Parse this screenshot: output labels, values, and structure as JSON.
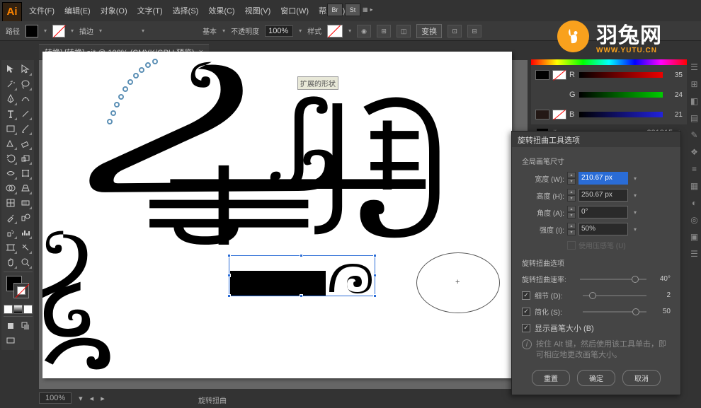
{
  "brand": {
    "name": "羽兔网",
    "url": "WWW.YUTU.CN"
  },
  "app_badge": "Ai",
  "menus": [
    "文件(F)",
    "编辑(E)",
    "对象(O)",
    "文字(T)",
    "选择(S)",
    "效果(C)",
    "视图(V)",
    "窗口(W)",
    "帮助(H)"
  ],
  "top_btn": {
    "br": "Br",
    "st": "St"
  },
  "ctrl": {
    "left_label": "路径",
    "stroke_label": "描边",
    "stroke_dd": "",
    "brush_style": "基本",
    "opacity_label": "不透明度",
    "opacity_value": "100%",
    "style_label": "样式",
    "transform_btn": "变换"
  },
  "doc_tab": {
    "title": "转换] [转换].ai* @ 100% (CMYK/GPU 预览)",
    "close": "×"
  },
  "tooltip": "扩展的形状",
  "right_panel": {
    "rows": [
      {
        "letter": "R",
        "val": "35"
      },
      {
        "letter": "G",
        "val": "24"
      },
      {
        "letter": "B",
        "val": "21"
      }
    ],
    "hex_label": "#",
    "hex": "231815"
  },
  "dialog": {
    "title": "旋转扭曲工具选项",
    "sec1": "全局画笔尺寸",
    "rows": [
      {
        "label": "宽度 (W):",
        "value": "210.67 px"
      },
      {
        "label": "高度 (H):",
        "value": "250.67 px"
      },
      {
        "label": "角度 (A):",
        "value": "0°"
      },
      {
        "label": "强度 (I):",
        "value": "50%"
      }
    ],
    "pressure": "使用压感笔 (U)",
    "sec2": "旋转扭曲选项",
    "sliders": [
      {
        "label": "旋转扭曲速率:",
        "value": "40°",
        "pos": 78,
        "cb": false
      },
      {
        "label": "细节 (D):",
        "value": "2",
        "pos": 10,
        "cb": true
      },
      {
        "label": "简化 (S):",
        "value": "50",
        "pos": 78,
        "cb": true
      }
    ],
    "show_size": "显示画笔大小 (B)",
    "info": "按住 Alt 键，然后使用该工具单击，即可相应地更改画笔大小。",
    "btns": {
      "reset": "重置",
      "ok": "确定",
      "cancel": "取消"
    }
  },
  "status": {
    "zoom": "100%",
    "mode": "旋转扭曲"
  },
  "tool_names": [
    "selection",
    "direct-select",
    "wand",
    "lasso",
    "pen",
    "curvature",
    "type",
    "line",
    "rect",
    "brush",
    "shaper",
    "eraser",
    "rotate",
    "scale",
    "width",
    "free-transform",
    "shape-builder",
    "perspective",
    "mesh",
    "gradient",
    "eyedropper",
    "blend",
    "symbol-spray",
    "graph",
    "artboard",
    "slice",
    "hand",
    "zoom"
  ],
  "color_modes": [
    "solid",
    "gradient",
    "none"
  ],
  "right_icons": [
    "props",
    "libs",
    "color",
    "swatches",
    "brushes",
    "symbols",
    "stroke",
    "grad",
    "trans",
    "appear",
    "graphic",
    "layers",
    "asset",
    "artbd"
  ]
}
